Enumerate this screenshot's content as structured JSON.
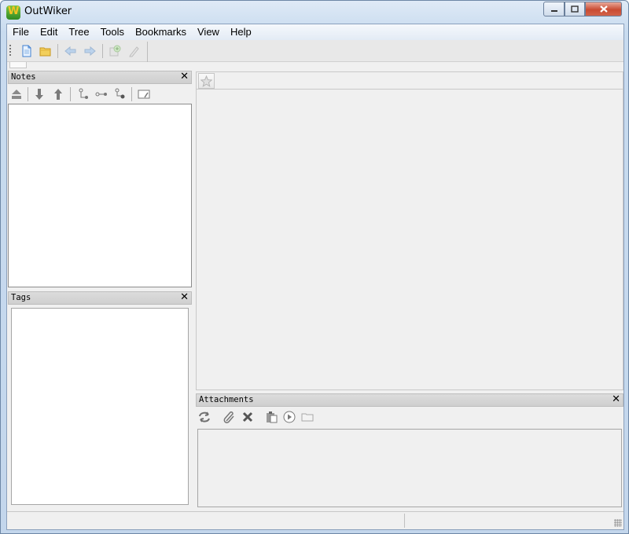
{
  "window": {
    "title": "OutWiker"
  },
  "menu": [
    "File",
    "Edit",
    "Tree",
    "Tools",
    "Bookmarks",
    "View",
    "Help"
  ],
  "toolbar": {
    "icons": [
      "new-note-icon",
      "open-folder-icon",
      "back-icon",
      "forward-icon",
      "add-bookmark-icon",
      "edit-icon"
    ]
  },
  "notes_panel": {
    "title": "Notes",
    "icons": [
      "eject-icon",
      "move-down-icon",
      "move-up-icon",
      "add-sibling-icon",
      "add-child-icon",
      "add-node-icon",
      "rename-icon"
    ]
  },
  "tags_panel": {
    "title": "Tags"
  },
  "attachments_panel": {
    "title": "Attachments",
    "icons": [
      "refresh-icon",
      "paperclip-icon",
      "delete-icon",
      "paste-icon",
      "play-icon",
      "folder-icon"
    ]
  },
  "colors": {
    "title_bar": "#c8dbef",
    "close_button": "#c94c32",
    "panel_header": "#d6d6d6"
  }
}
